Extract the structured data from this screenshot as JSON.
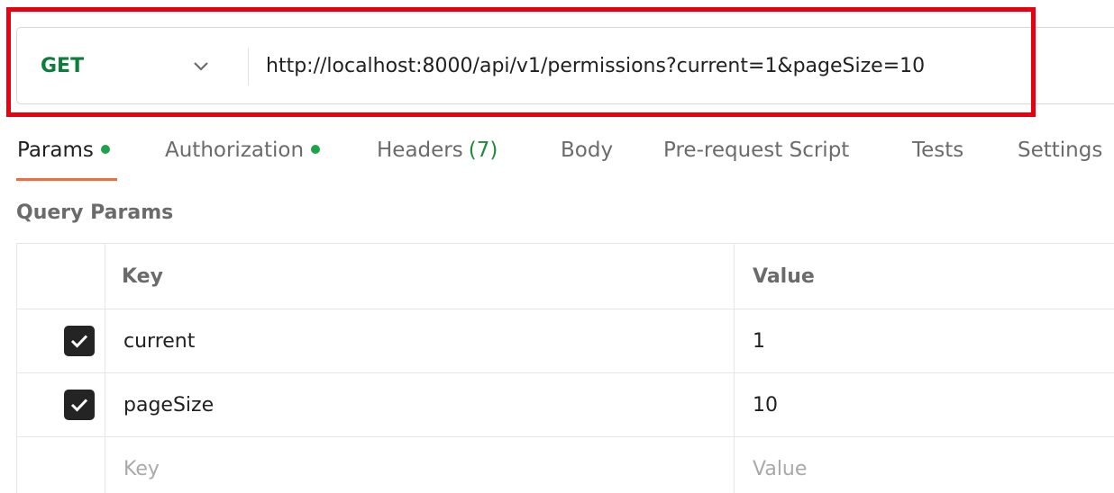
{
  "request": {
    "method": "GET",
    "url": "http://localhost:8000/api/v1/permissions?current=1&pageSize=10"
  },
  "tabs": [
    {
      "label": "Params",
      "dot": true
    },
    {
      "label": "Authorization",
      "dot": true
    },
    {
      "label": "Headers",
      "count": "(7)"
    },
    {
      "label": "Body"
    },
    {
      "label": "Pre-request Script"
    },
    {
      "label": "Tests"
    },
    {
      "label": "Settings"
    }
  ],
  "active_tab": "Params",
  "query_params": {
    "title": "Query Params",
    "columns": {
      "key": "Key",
      "value": "Value"
    },
    "rows": [
      {
        "checked": true,
        "key": "current",
        "value": "1"
      },
      {
        "checked": true,
        "key": "pageSize",
        "value": "10"
      }
    ],
    "new_row": {
      "key_placeholder": "Key",
      "value_placeholder": "Value"
    }
  },
  "icons": {
    "method_dropdown": "chevron-down-icon",
    "row_checkbox": "check-icon"
  },
  "colors": {
    "method_get": "#0c7d3a",
    "tab_dot": "#1fa34a",
    "headers_count": "#1f8a3a",
    "tab_underline": "#f26b3a",
    "highlight": "#e8000e"
  }
}
